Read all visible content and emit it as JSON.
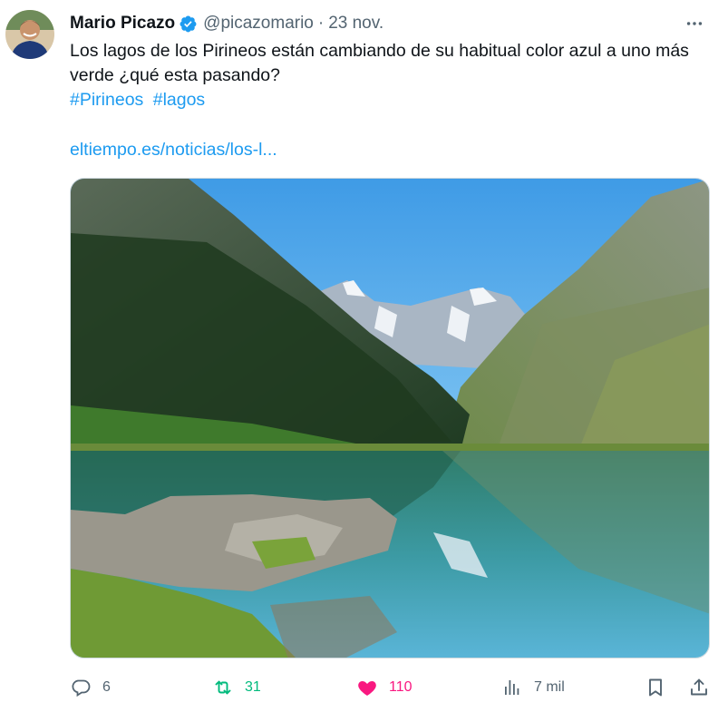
{
  "tweet": {
    "author": {
      "name": "Mario Picazo",
      "handle": "@picazomario",
      "verified_icon": "verified-badge-icon"
    },
    "separator": "·",
    "date": "23 nov.",
    "text": "Los lagos de los Pirineos están cambiando de su habitual color azul a uno más verde ¿qué esta pasando?",
    "hashtags": [
      "#Pirineos",
      "#lagos"
    ],
    "link": "eltiempo.es/noticias/los-l...",
    "media": {
      "alt": "mountain-lake-photo"
    }
  },
  "actions": {
    "replies": "6",
    "retweets": "31",
    "likes": "110",
    "views": "7 mil"
  },
  "colors": {
    "accent": "#1d9bf0",
    "retweet": "#00ba7c",
    "like": "#f91880",
    "muted": "#536471"
  }
}
